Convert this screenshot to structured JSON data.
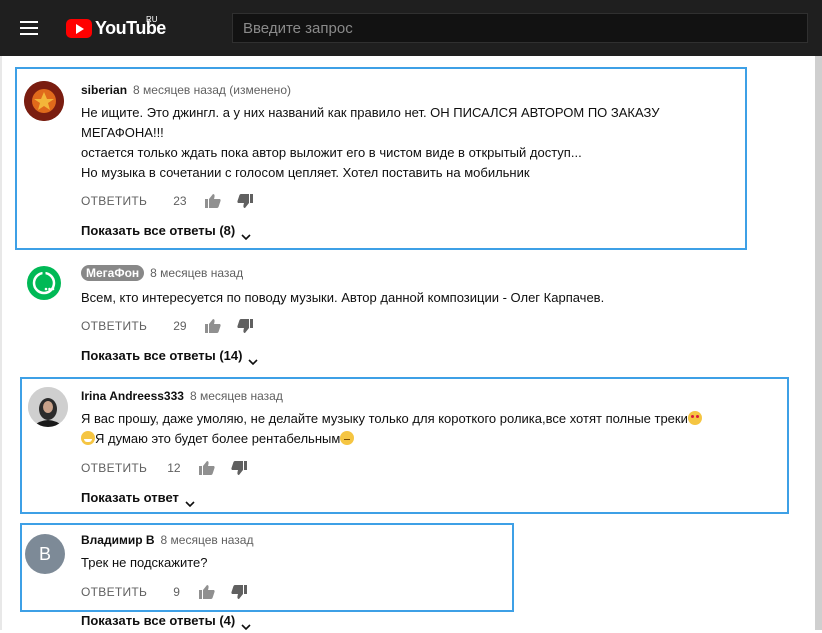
{
  "header": {
    "logo_text": "YouTube",
    "logo_region": "RU",
    "search_placeholder": "Введите запрос"
  },
  "comments": [
    {
      "author": "siberian",
      "time": "8 месяцев назад (изменено)",
      "text": [
        "Не ищите. Это джингл. а у них названий как правило нет.  ОН ПИСАЛСЯ АВТОРОМ ПО ЗАКАЗУ",
        "МЕГАФОНА!!!",
        "остается только ждать пока автор выложит его в чистом виде в открытый доступ...",
        "Но музыка в сочетании с голосом цепляет. Хотел поставить на мобильник"
      ],
      "reply_label": "ОТВЕТИТЬ",
      "likes": "23",
      "show_replies": "Показать все ответы (8)"
    },
    {
      "author": "МегаФон",
      "time": "8 месяцев назад",
      "text": [
        "Всем, кто интересуется по поводу музыки. Автор данной композиции - Олег Карпачев."
      ],
      "reply_label": "ОТВЕТИТЬ",
      "likes": "29",
      "show_replies": "Показать все ответы (14)"
    },
    {
      "author": "Irina Andreess333",
      "time": "8 месяцев назад",
      "text_line1": "Я вас прошу, даже умоляю, не делайте музыку только для короткого ролика,все хотят полные треки",
      "text_line2": "Я думаю это будет более рентабельным",
      "reply_label": "ОТВЕТИТЬ",
      "likes": "12",
      "show_replies": "Показать ответ"
    },
    {
      "author": "Владимир В",
      "avatar_letter": "В",
      "time": "8 месяцев назад",
      "text": [
        "Трек не подскажите?"
      ],
      "reply_label": "ОТВЕТИТЬ",
      "likes": "9",
      "show_replies": "Показать все ответы (4)"
    }
  ],
  "colors": {
    "highlight": "#3ea0e6",
    "topbar": "#1f1f1f",
    "brand_red": "#ff0000",
    "megafon_green": "#00b956"
  },
  "icons": [
    "menu-icon",
    "youtube-logo-icon",
    "thumb-up-icon",
    "thumb-down-icon",
    "chevron-down-icon"
  ]
}
